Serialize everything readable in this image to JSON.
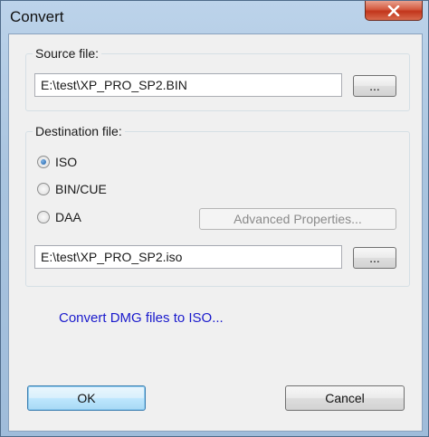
{
  "window": {
    "title": "Convert"
  },
  "source": {
    "label": "Source file:",
    "path": "E:\\test\\XP_PRO_SP2.BIN",
    "browse_label": "..."
  },
  "destination": {
    "label": "Destination file:",
    "formats": [
      {
        "label": "ISO",
        "checked": true
      },
      {
        "label": "BIN/CUE",
        "checked": false
      },
      {
        "label": "DAA",
        "checked": false
      }
    ],
    "advanced_label": "Advanced Properties...",
    "path": "E:\\test\\XP_PRO_SP2.iso",
    "browse_label": "..."
  },
  "link": {
    "text": "Convert DMG files to ISO..."
  },
  "buttons": {
    "ok": "OK",
    "cancel": "Cancel"
  },
  "colors": {
    "link": "#1a1acc",
    "close_button": "#c2351b",
    "frame": "#a9c4df"
  },
  "icons": {
    "close": "close-icon"
  }
}
